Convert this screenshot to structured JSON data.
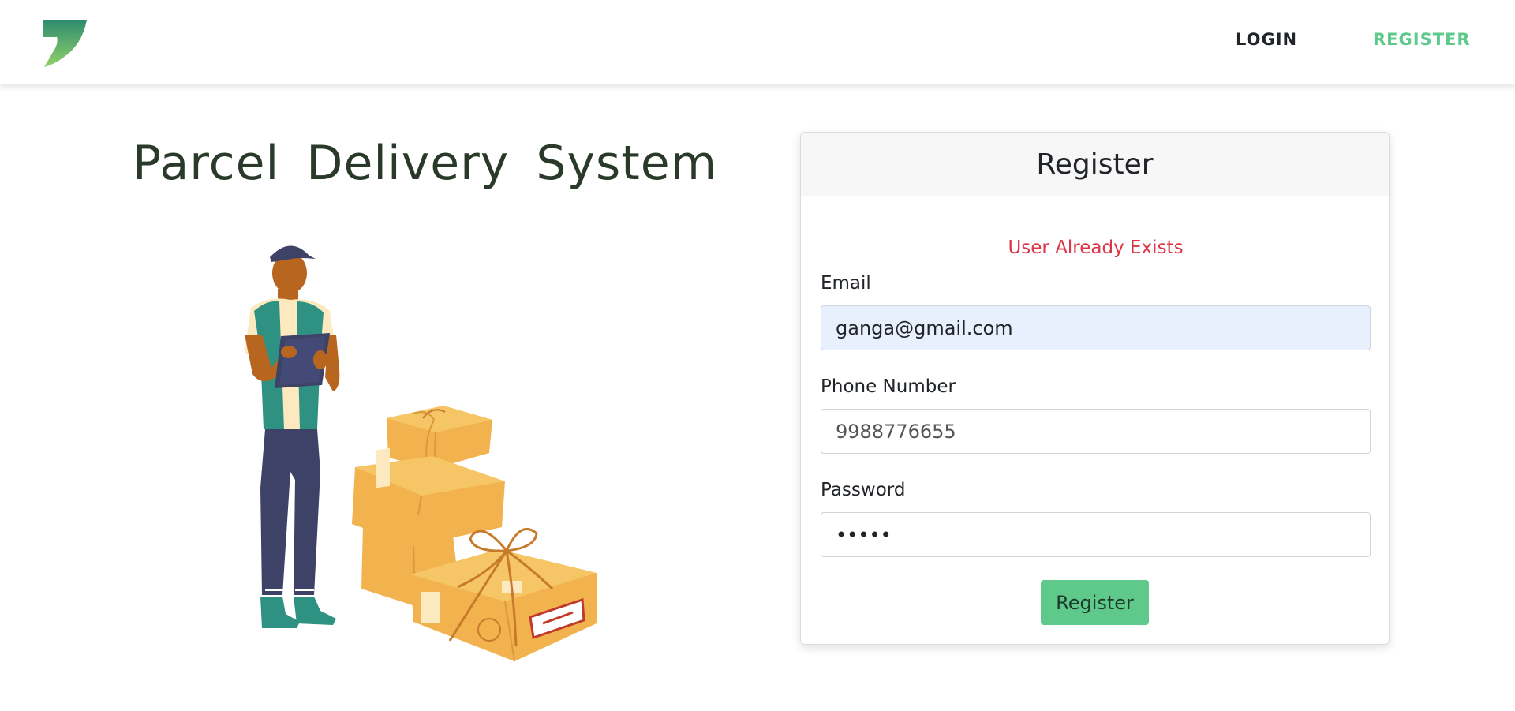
{
  "colors": {
    "accent": "#5fc98b",
    "heading": "#2a3a2a",
    "error": "#dc3545",
    "autofill": "#e8f0fe"
  },
  "nav": {
    "logo_icon": "leaf-logo-icon",
    "login_label": "LOGIN",
    "register_label": "REGISTER"
  },
  "hero": {
    "title": "Parcel Delivery System",
    "illustration": "delivery-man-with-parcels-illustration"
  },
  "form": {
    "title": "Register",
    "error": "User Already Exists",
    "email_label": "Email",
    "email_value": "ganga@gmail.com",
    "phone_label": "Phone Number",
    "phone_value": "9988776655",
    "password_label": "Password",
    "password_value": "•••••",
    "submit_label": "Register"
  }
}
